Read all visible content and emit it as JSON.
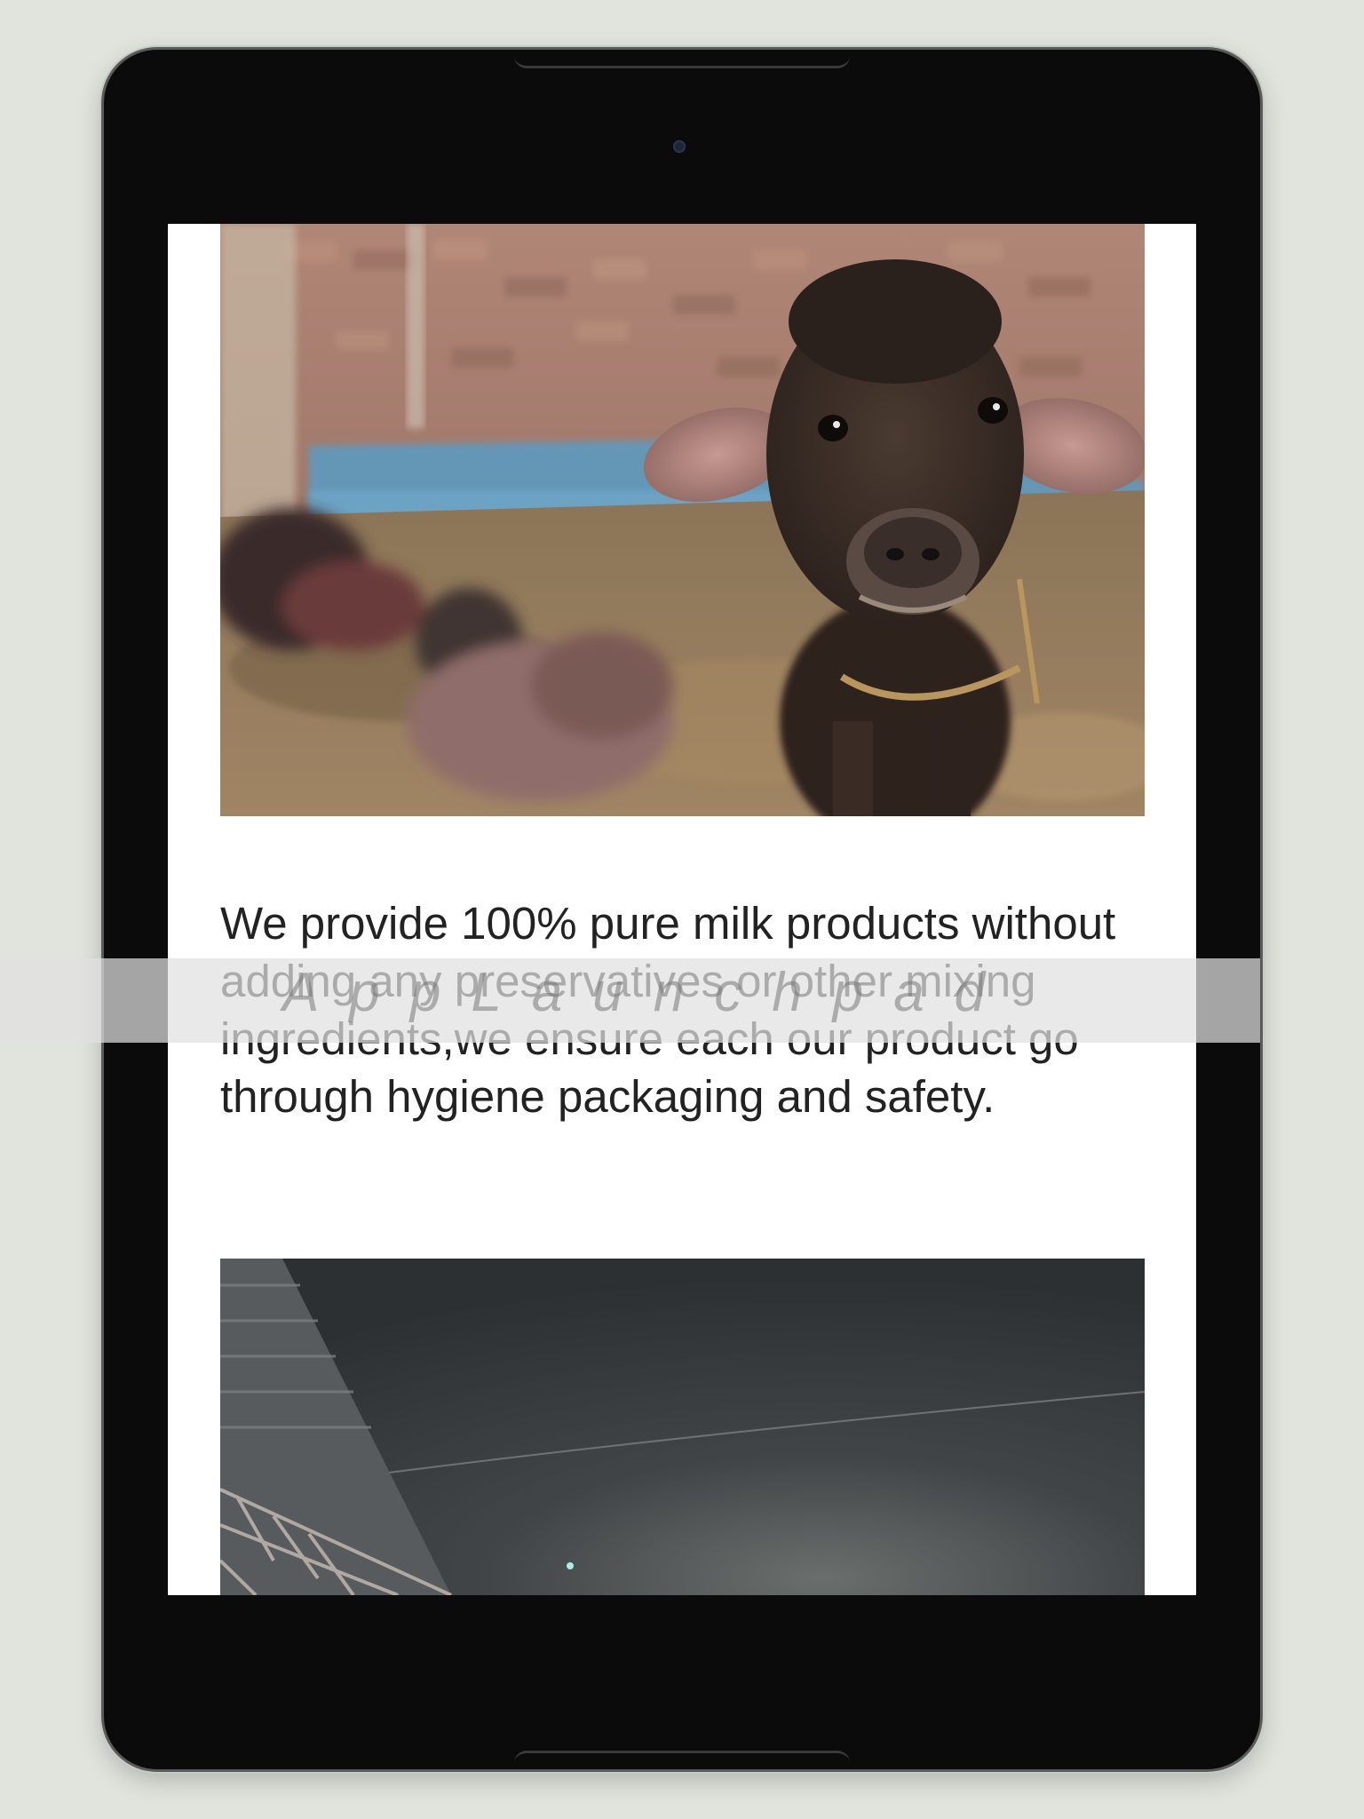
{
  "content": {
    "description": "We provide 100% pure milk products without adding any preservatives or other mixing ingredients,we ensure each our product go through hygiene packaging and safety."
  },
  "watermark": {
    "text": "AppLaunchpad"
  },
  "colors": {
    "background": "#e1e4dd",
    "device_bezel": "#0b0b0b",
    "screen": "#ffffff",
    "text": "#222222"
  }
}
